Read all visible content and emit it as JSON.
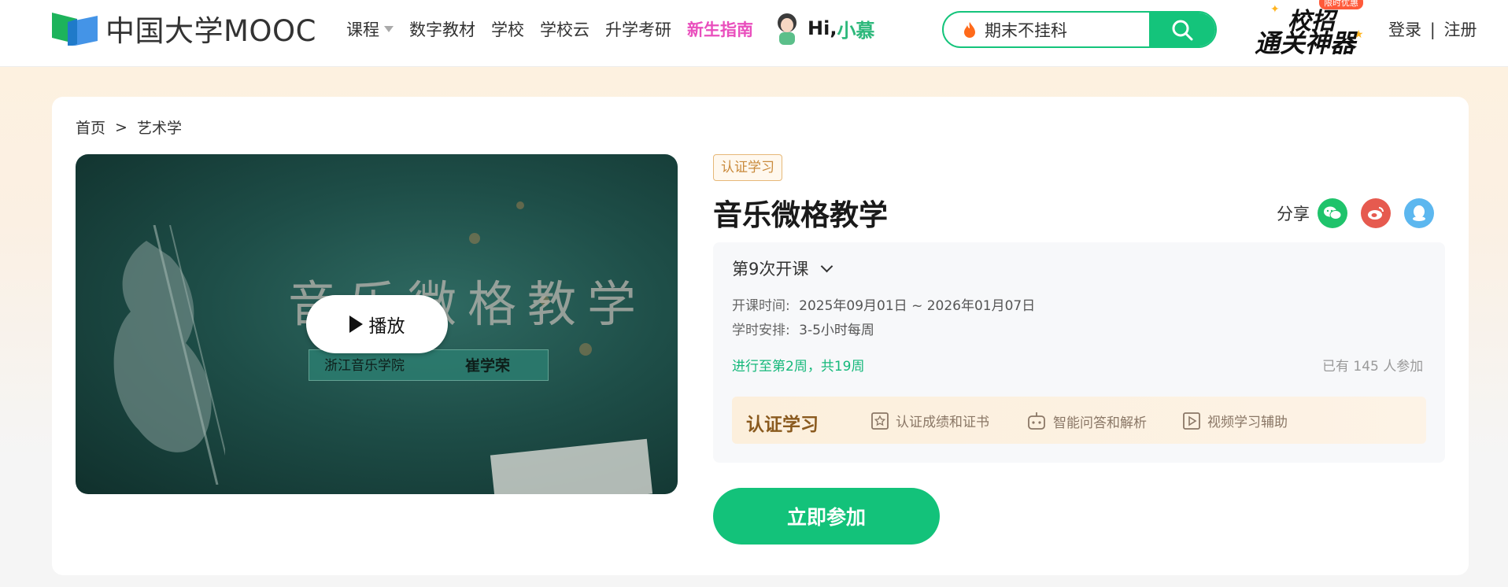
{
  "header": {
    "logo_text": "中国大学MOOC",
    "nav": [
      {
        "label": "课程",
        "has_caret": true
      },
      {
        "label": "数字教材"
      },
      {
        "label": "学校"
      },
      {
        "label": "学校云"
      },
      {
        "label": "升学考研"
      },
      {
        "label": "新生指南",
        "highlight": true
      }
    ],
    "greeting": "Hi,",
    "greeting_name": "小慕",
    "search": {
      "value": "期末不挂科",
      "icon": "search-icon"
    },
    "promo": {
      "badge": "限时优惠",
      "line1": "校招",
      "line2": "通关神器"
    },
    "login": "登录",
    "divider": "|",
    "register": "注册"
  },
  "breadcrumb": {
    "home": "首页",
    "separator": ">",
    "current": "艺术学"
  },
  "video": {
    "title_overlay": "音乐微格教学",
    "school": "浙江音乐学院",
    "author": "崔学荣",
    "play_label": "播放"
  },
  "course": {
    "tag": "认证学习",
    "title": "音乐微格教学",
    "share_label": "分享",
    "share_icons": [
      "wechat-icon",
      "weibo-icon",
      "qq-icon"
    ],
    "session": "第9次开课",
    "time_label": "开课时间:",
    "time_value": "2025年09月01日 ~ 2026年01月07日",
    "schedule_label": "学时安排:",
    "schedule_value": "3-5小时每周",
    "progress": "进行至第2周，共19周",
    "participants": "已有 145 人参加",
    "cert": {
      "title": "认证学习",
      "features": [
        "认证成绩和证书",
        "智能问答和解析",
        "视频学习辅助"
      ]
    },
    "join_label": "立即参加"
  },
  "colors": {
    "brand_green": "#14c47b",
    "guide_pink": "#e94fbd",
    "tag_gold": "#c98a3c"
  }
}
